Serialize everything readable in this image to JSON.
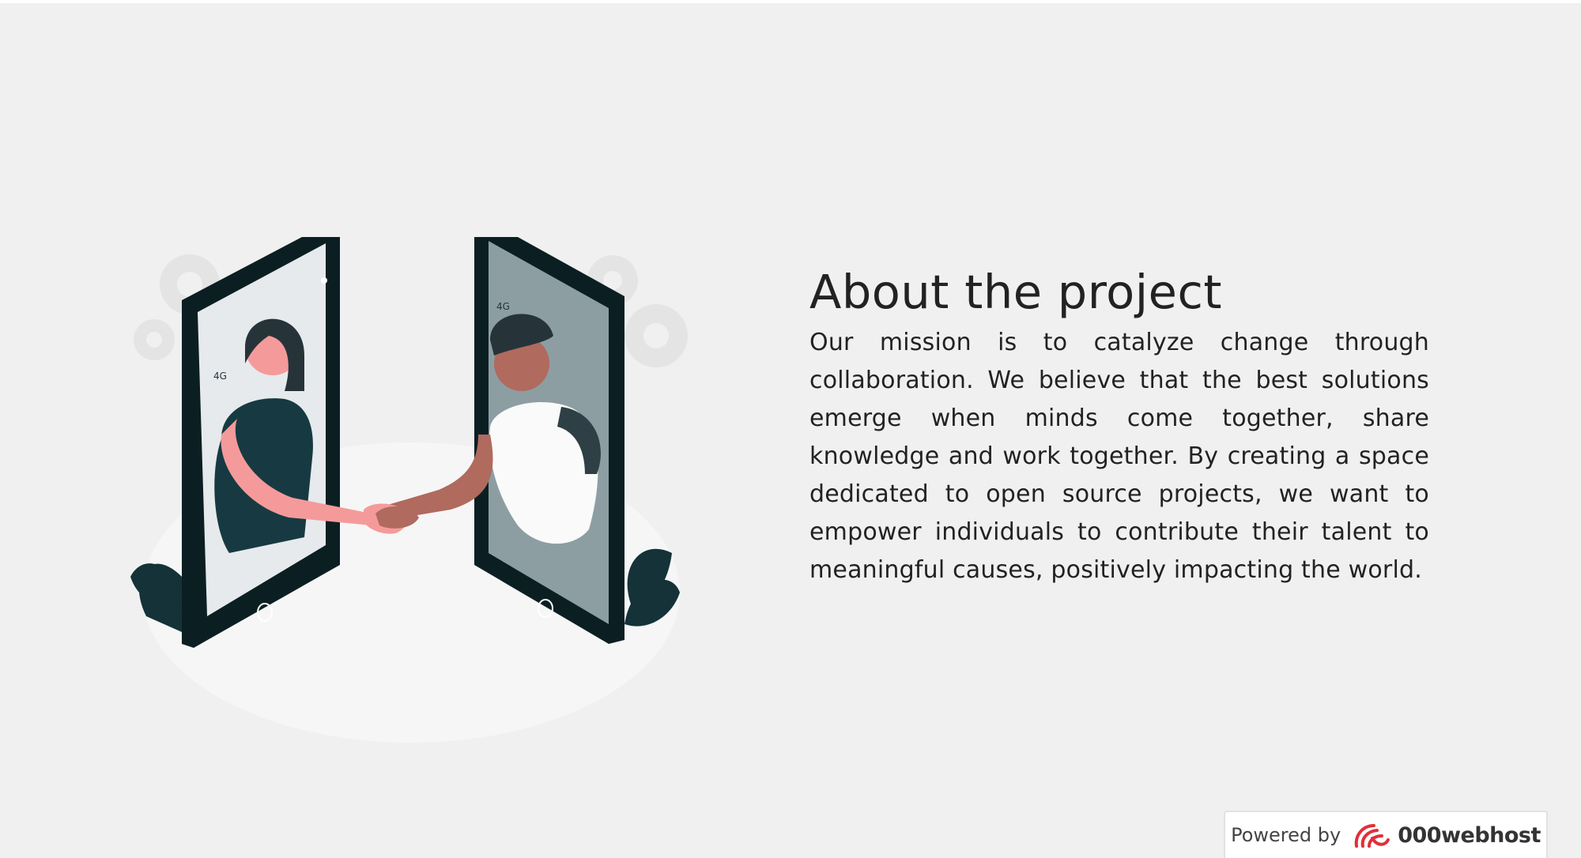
{
  "about": {
    "title": "About the project",
    "description": "Our mission is to catalyze change through collaboration. We believe that the best solutions emerge when minds come together, share knowledge and work together. By creating a space dedicated to open source projects, we want to empower individuals to contribute their talent to meaningful causes, positively impacting the world."
  },
  "illustration": {
    "icon": "handshake-phones-illustration",
    "left_phone_status": "4G",
    "right_phone_status": "4G"
  },
  "footer": {
    "powered_by_label": "Powered by",
    "brand_name": "000webhost",
    "brand_icon": "000webhost-logo-icon"
  },
  "colors": {
    "background": "#f0f0f0",
    "text": "#222222",
    "phone_dark": "#0e2a30",
    "accent_teal": "#1e3a40",
    "brand_red": "#e0303a"
  }
}
